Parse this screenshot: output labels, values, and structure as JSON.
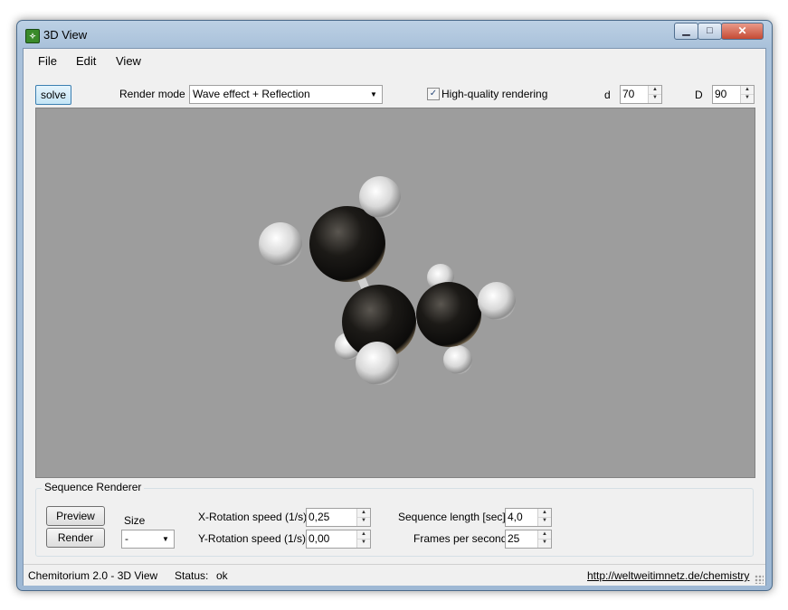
{
  "window": {
    "title": "3D View",
    "icon": "chemistry-app-icon"
  },
  "menu": [
    "File",
    "Edit",
    "View"
  ],
  "toolbar": {
    "solve_label": "solve",
    "render_mode_label": "Render mode",
    "render_mode_value": "Wave effect + Reflection",
    "hq_label": "High-quality rendering",
    "hq_checked": true,
    "d_label": "d",
    "d_value": "70",
    "D_label": "D",
    "D_value": "90"
  },
  "colors": {
    "viewport_bg": "#9d9d9d",
    "carbon": "#1c1a17",
    "hydrogen": "#e6e6e6",
    "bond": "#d4d4d4"
  },
  "sequence": {
    "title": "Sequence Renderer",
    "preview_label": "Preview",
    "render_label": "Render",
    "size_label": "Size",
    "size_value": "-",
    "xrot_label": "X-Rotation speed (1/s)",
    "xrot_value": "0,25",
    "yrot_label": "Y-Rotation speed (1/s)",
    "yrot_value": "0,00",
    "seq_len_label": "Sequence length [sec]",
    "seq_len_value": "4,0",
    "fps_label": "Frames per second",
    "fps_value": "25"
  },
  "status": {
    "app": "Chemitorium 2.0 - 3D View",
    "label": "Status:",
    "value": "ok",
    "link": "http://weltweitimnetz.de/chemistry"
  }
}
